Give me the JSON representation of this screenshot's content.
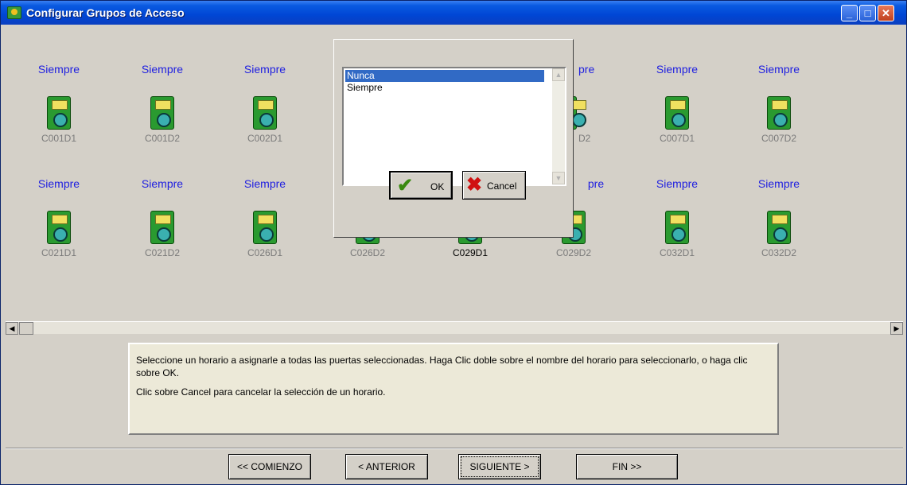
{
  "window": {
    "title": "Configurar Grupos de Acceso",
    "min_glyph": "_",
    "max_glyph": "□",
    "close_glyph": "✕"
  },
  "doors_row1": [
    {
      "schedule": "Siempre",
      "code": "C001D1"
    },
    {
      "schedule": "Siempre",
      "code": "C001D2"
    },
    {
      "schedule": "Siempre",
      "code": "C002D1"
    },
    {
      "schedule": "pre",
      "code": "D2"
    },
    {
      "schedule": "Siempre",
      "code": "C007D1"
    },
    {
      "schedule": "Siempre",
      "code": "C007D2"
    }
  ],
  "doors_row2": [
    {
      "schedule": "Siempre",
      "code": "C021D1"
    },
    {
      "schedule": "Siempre",
      "code": "C021D2"
    },
    {
      "schedule": "Siempre",
      "code": "C026D1"
    },
    {
      "schedule": "",
      "code": "C026D2"
    },
    {
      "schedule": "",
      "code": "C029D1"
    },
    {
      "schedule": "pre",
      "code": "C029D2"
    },
    {
      "schedule": "Siempre",
      "code": "C032D1"
    },
    {
      "schedule": "Siempre",
      "code": "C032D2"
    }
  ],
  "scrollbar": {
    "left_arrow": "◀",
    "right_arrow": "▶"
  },
  "info": {
    "line1": "Seleccione un horario a asignarle a todas las puertas seleccionadas. Haga Clic doble sobre el nombre del horario para seleccionarlo, o haga clic sobre OK.",
    "line2": "Clic sobre Cancel para cancelar la selección de un horario."
  },
  "nav": {
    "start": "<< COMIENZO",
    "prev": "< ANTERIOR",
    "next": "SIGUIENTE >",
    "end": "FIN >>"
  },
  "dialog": {
    "options": [
      "Nunca",
      "Siempre"
    ],
    "selected": "Nunca",
    "ok_label": "OK",
    "cancel_label": "Cancel",
    "ok_glyph": "✔",
    "cancel_glyph": "✖",
    "scroll_up": "▲",
    "scroll_down": "▼"
  },
  "colors": {
    "schedule_text": "#2020e0",
    "selection": "#316ac5",
    "titlebar": "#0046d5"
  },
  "icons": [
    "schedule-device-icon",
    "checkmark-icon",
    "x-icon",
    "arrow-cursor-icon"
  ]
}
